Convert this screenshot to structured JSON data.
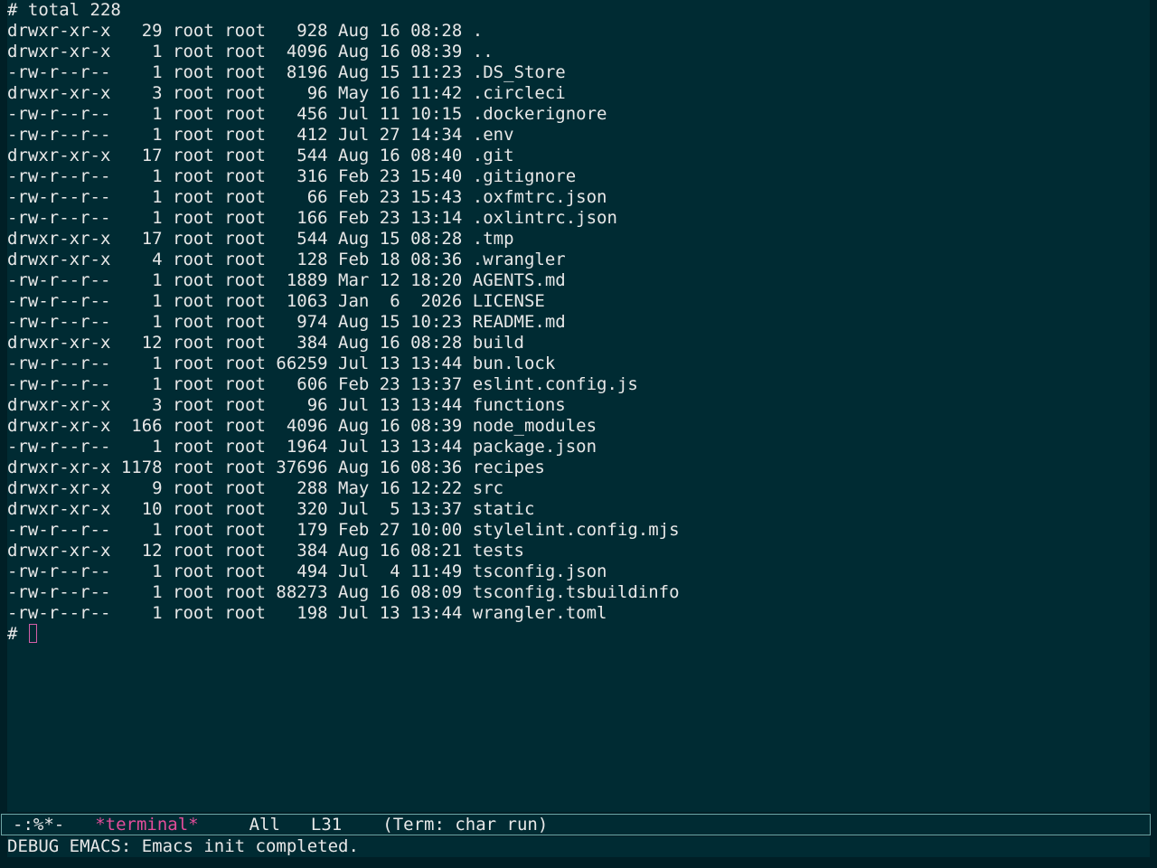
{
  "terminal": {
    "lines": [
      "# total 228",
      "drwxr-xr-x   29 root root   928 Aug 16 08:28 .",
      "drwxr-xr-x    1 root root  4096 Aug 16 08:39 ..",
      "-rw-r--r--    1 root root  8196 Aug 15 11:23 .DS_Store",
      "drwxr-xr-x    3 root root    96 May 16 11:42 .circleci",
      "-rw-r--r--    1 root root   456 Jul 11 10:15 .dockerignore",
      "-rw-r--r--    1 root root   412 Jul 27 14:34 .env",
      "drwxr-xr-x   17 root root   544 Aug 16 08:40 .git",
      "-rw-r--r--    1 root root   316 Feb 23 15:40 .gitignore",
      "-rw-r--r--    1 root root    66 Feb 23 15:43 .oxfmtrc.json",
      "-rw-r--r--    1 root root   166 Feb 23 13:14 .oxlintrc.json",
      "drwxr-xr-x   17 root root   544 Aug 15 08:28 .tmp",
      "drwxr-xr-x    4 root root   128 Feb 18 08:36 .wrangler",
      "-rw-r--r--    1 root root  1889 Mar 12 18:20 AGENTS.md",
      "-rw-r--r--    1 root root  1063 Jan  6  2026 LICENSE",
      "-rw-r--r--    1 root root   974 Aug 15 10:23 README.md",
      "drwxr-xr-x   12 root root   384 Aug 16 08:28 build",
      "-rw-r--r--    1 root root 66259 Jul 13 13:44 bun.lock",
      "-rw-r--r--    1 root root   606 Feb 23 13:37 eslint.config.js",
      "drwxr-xr-x    3 root root    96 Jul 13 13:44 functions",
      "drwxr-xr-x  166 root root  4096 Aug 16 08:39 node_modules",
      "-rw-r--r--    1 root root  1964 Jul 13 13:44 package.json",
      "drwxr-xr-x 1178 root root 37696 Aug 16 08:36 recipes",
      "drwxr-xr-x    9 root root   288 May 16 12:22 src",
      "drwxr-xr-x   10 root root   320 Jul  5 13:37 static",
      "-rw-r--r--    1 root root   179 Feb 27 10:00 stylelint.config.mjs",
      "drwxr-xr-x   12 root root   384 Aug 16 08:21 tests",
      "-rw-r--r--    1 root root   494 Jul  4 11:49 tsconfig.json",
      "-rw-r--r--    1 root root 88273 Aug 16 08:09 tsconfig.tsbuildinfo",
      "-rw-r--r--    1 root root   198 Jul 13 13:44 wrangler.toml"
    ],
    "prompt": "# "
  },
  "mode_line": {
    "status": "-:%*-",
    "buffer_name": "*terminal*",
    "position": "All",
    "line": "L31",
    "mode": "(Term: char run)"
  },
  "echo_area": {
    "message": "DEBUG EMACS: Emacs init completed."
  },
  "colors": {
    "buffer_background": "#002b33",
    "frame_background": "#001f26",
    "foreground": "#e8e8e8",
    "buffer_name": "#e24d9a",
    "cursor": "#d35fa8",
    "mode_line_border": "#6fa6a6"
  }
}
